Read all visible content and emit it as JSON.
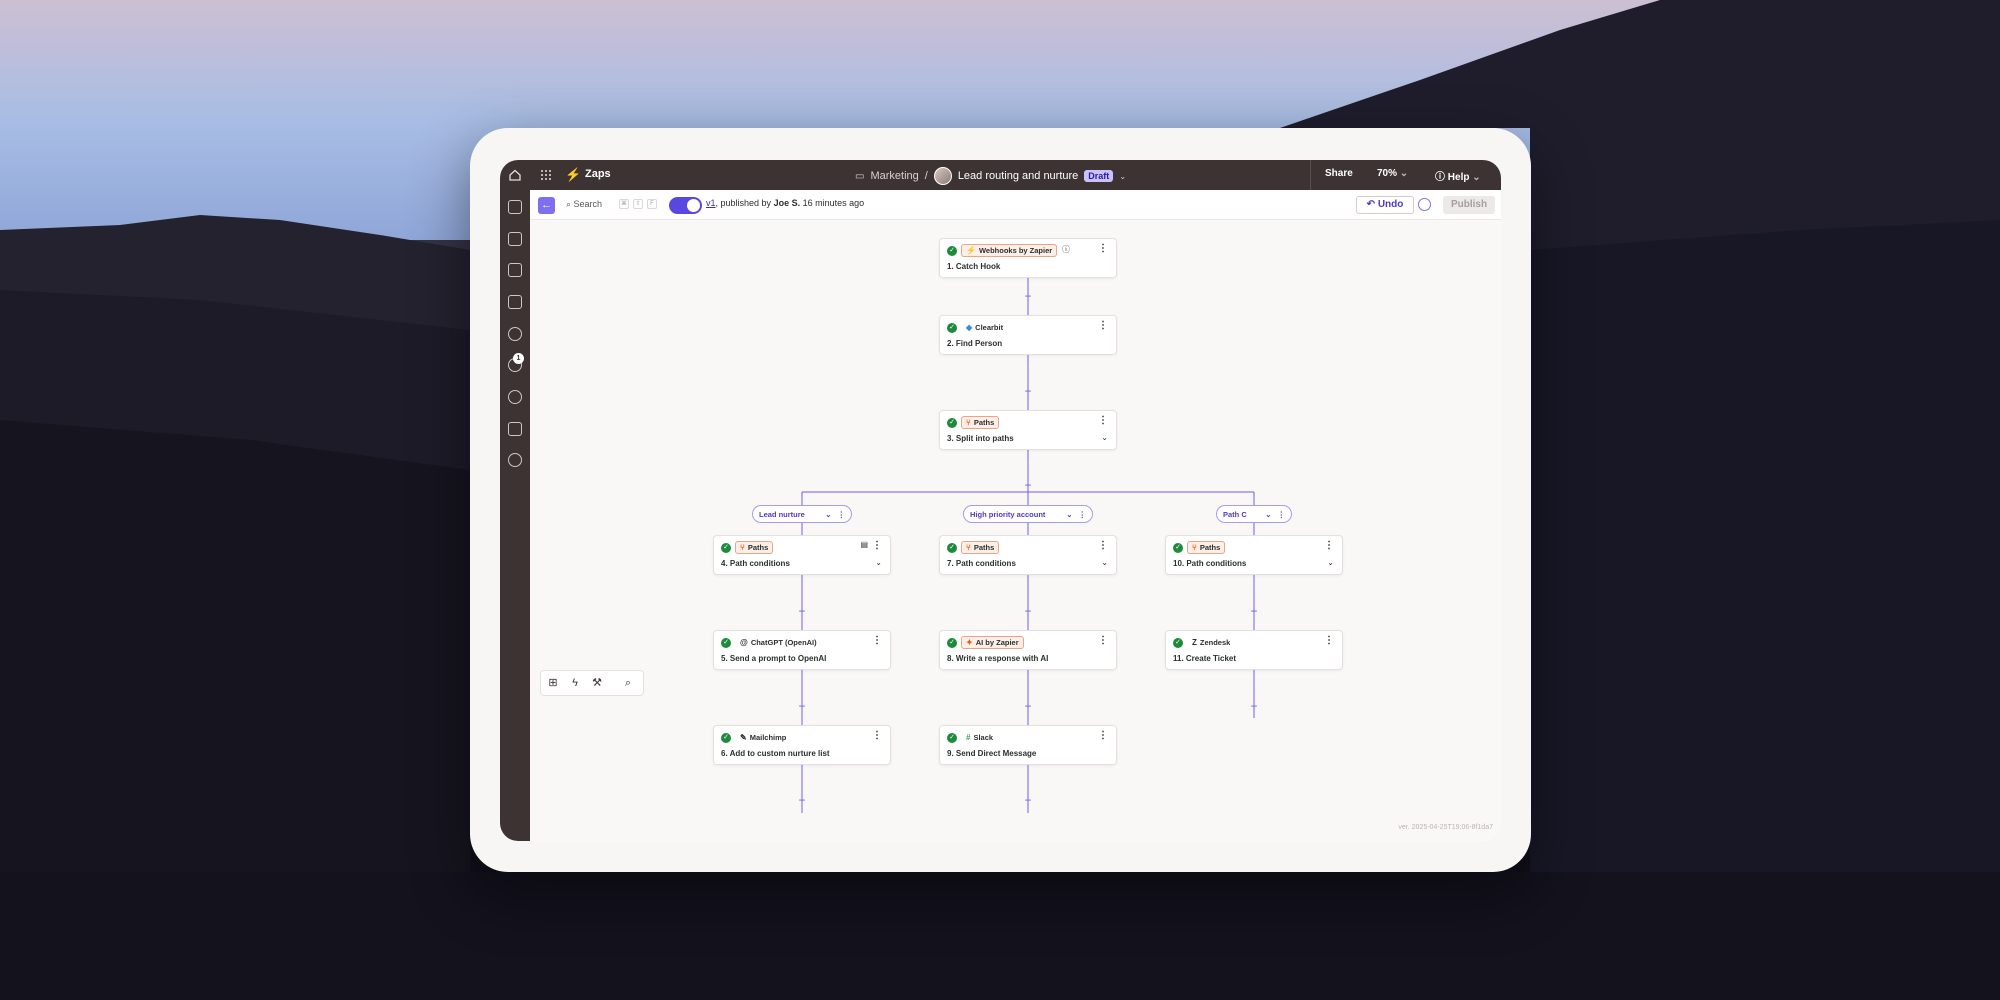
{
  "topbar": {
    "app_name": "Zaps",
    "folder": "Marketing",
    "separator": "/",
    "zap_title": "Lead routing and nurture",
    "status_badge": "Draft",
    "share_label": "Share",
    "zoom_label": "70%",
    "help_label": "Help"
  },
  "sidebar": {
    "items": [
      {
        "icon": "apps-icon"
      },
      {
        "icon": "document-icon"
      },
      {
        "icon": "chat-icon"
      },
      {
        "icon": "calendar-icon"
      },
      {
        "icon": "history-icon"
      },
      {
        "icon": "activity-icon",
        "badge": "1"
      },
      {
        "icon": "settings-icon"
      },
      {
        "icon": "stack-icon"
      },
      {
        "icon": "bug-icon"
      }
    ]
  },
  "subbar": {
    "search_label": "Search",
    "shortcut_keys": [
      "⌘",
      "⇧",
      "F"
    ],
    "version": "v1",
    "published_by_prefix": ", published by ",
    "publisher": "Joe S.",
    "published_time": " 16 minutes ago",
    "undo_label": "Undo",
    "publish_label": "Publish"
  },
  "steps": {
    "s1": {
      "app": "Webhooks by Zapier",
      "title": "1. Catch Hook"
    },
    "s2": {
      "app": "Clearbit",
      "title": "2. Find Person"
    },
    "s3": {
      "app": "Paths",
      "title": "3. Split into paths"
    },
    "s4": {
      "app": "Paths",
      "title": "4. Path conditions"
    },
    "s5": {
      "app": "ChatGPT (OpenAI)",
      "title": "5. Send a prompt to OpenAI"
    },
    "s6": {
      "app": "Mailchimp",
      "title": "6. Add to custom nurture list"
    },
    "s7": {
      "app": "Paths",
      "title": "7. Path conditions"
    },
    "s8": {
      "app": "AI by Zapier",
      "title": "8. Write a response with AI"
    },
    "s9": {
      "app": "Slack",
      "title": "9. Send Direct Message"
    },
    "s10": {
      "app": "Paths",
      "title": "10. Path conditions"
    },
    "s11": {
      "app": "Zendesk",
      "title": "11. Create Ticket"
    }
  },
  "paths": {
    "a": "Lead nurture",
    "b": "High priority account",
    "c": "Path C"
  },
  "version_note": "ver. 2025-04-25T19:06-8f1da7",
  "colors": {
    "accent": "#6f5ef0",
    "topbar": "#3d3333",
    "success": "#1d8a3c",
    "brand": "#ff4f00"
  }
}
